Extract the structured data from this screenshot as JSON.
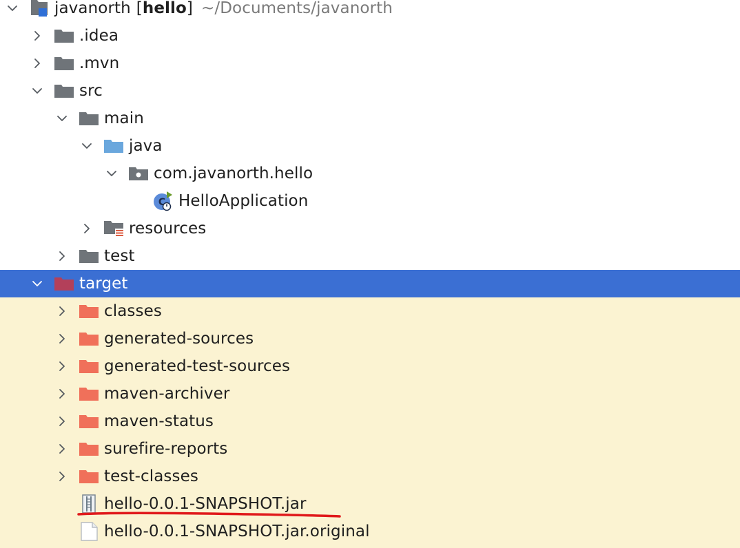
{
  "project": {
    "name": "javanorth",
    "module_bracket_open": "[",
    "module": "hello",
    "module_bracket_close": "]",
    "path": "~/Documents/javanorth"
  },
  "tree": [
    {
      "label": "javanorth",
      "icon": "project-module-icon",
      "depth": 0,
      "expanded": true,
      "top": true
    },
    {
      "label": ".idea",
      "icon": "folder-icon",
      "depth": 1,
      "expanded": false
    },
    {
      "label": ".mvn",
      "icon": "folder-icon",
      "depth": 1,
      "expanded": false
    },
    {
      "label": "src",
      "icon": "folder-icon",
      "depth": 1,
      "expanded": true
    },
    {
      "label": "main",
      "icon": "folder-icon",
      "depth": 2,
      "expanded": true
    },
    {
      "label": "java",
      "icon": "source-root-folder-icon",
      "depth": 3,
      "expanded": true
    },
    {
      "label": "com.javanorth.hello",
      "icon": "package-icon",
      "depth": 4,
      "expanded": true
    },
    {
      "label": "HelloApplication",
      "icon": "spring-boot-class-icon",
      "depth": 5,
      "leaf": true
    },
    {
      "label": "resources",
      "icon": "resources-folder-icon",
      "depth": 3,
      "expanded": false
    },
    {
      "label": "test",
      "icon": "folder-icon",
      "depth": 2,
      "expanded": false
    },
    {
      "label": "target",
      "icon": "excluded-folder-icon",
      "depth": 1,
      "expanded": true,
      "selected": true
    },
    {
      "label": "classes",
      "icon": "excluded-folder-icon",
      "depth": 2,
      "expanded": false
    },
    {
      "label": "generated-sources",
      "icon": "excluded-folder-icon",
      "depth": 2,
      "expanded": false
    },
    {
      "label": "generated-test-sources",
      "icon": "excluded-folder-icon",
      "depth": 2,
      "expanded": false
    },
    {
      "label": "maven-archiver",
      "icon": "excluded-folder-icon",
      "depth": 2,
      "expanded": false
    },
    {
      "label": "maven-status",
      "icon": "excluded-folder-icon",
      "depth": 2,
      "expanded": false
    },
    {
      "label": "surefire-reports",
      "icon": "excluded-folder-icon",
      "depth": 2,
      "expanded": false
    },
    {
      "label": "test-classes",
      "icon": "excluded-folder-icon",
      "depth": 2,
      "expanded": false
    },
    {
      "label": "hello-0.0.1-SNAPSHOT.jar",
      "icon": "jar-archive-icon",
      "depth": 2,
      "leaf": true,
      "annotated": true
    },
    {
      "label": "hello-0.0.1-SNAPSHOT.jar.original",
      "icon": "file-icon",
      "depth": 2,
      "leaf": true
    }
  ],
  "colors": {
    "selection": "#3b6fd3",
    "excluded_background": "#fbf3d2",
    "folder_gray": "#6f7479",
    "folder_excluded": "#f0705a",
    "folder_excluded_selected": "#b3405a",
    "source_root": "#6aa7dd",
    "annotation_underline": "#e0191b"
  }
}
